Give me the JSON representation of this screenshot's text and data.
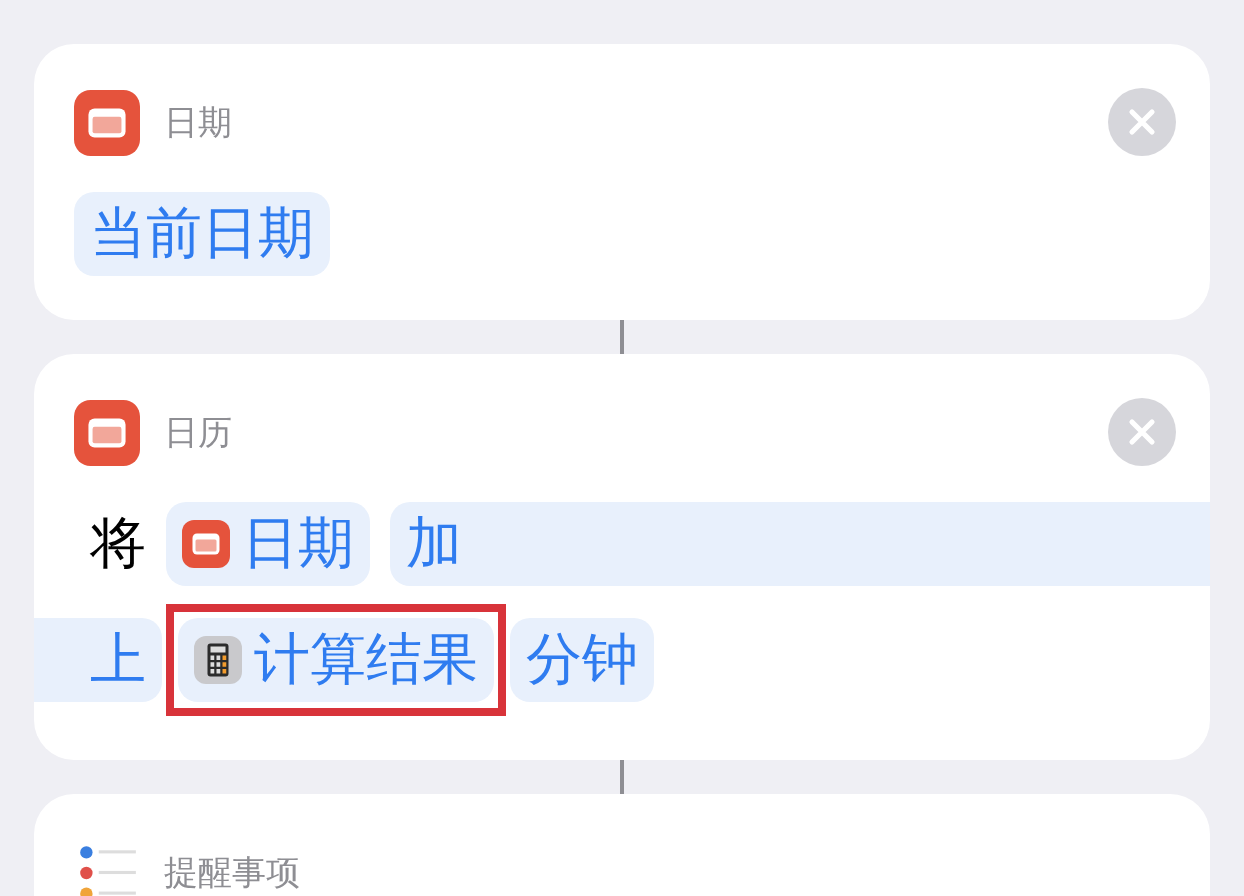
{
  "cards": [
    {
      "title": "日期",
      "closable": true,
      "parts": [
        {
          "kind": "param",
          "text": "当前日期"
        }
      ]
    },
    {
      "title": "日历",
      "closable": true,
      "parts": [
        {
          "kind": "text",
          "text": "将"
        },
        {
          "kind": "variable",
          "text": "日期"
        },
        {
          "kind": "wraphead",
          "text": "加"
        },
        {
          "kind": "wraptail",
          "text": "上"
        },
        {
          "kind": "variable",
          "text": "计算结果",
          "highlighted": true
        },
        {
          "kind": "param",
          "text": "分钟"
        }
      ]
    },
    {
      "title": "提醒事项",
      "closable": false
    }
  ]
}
